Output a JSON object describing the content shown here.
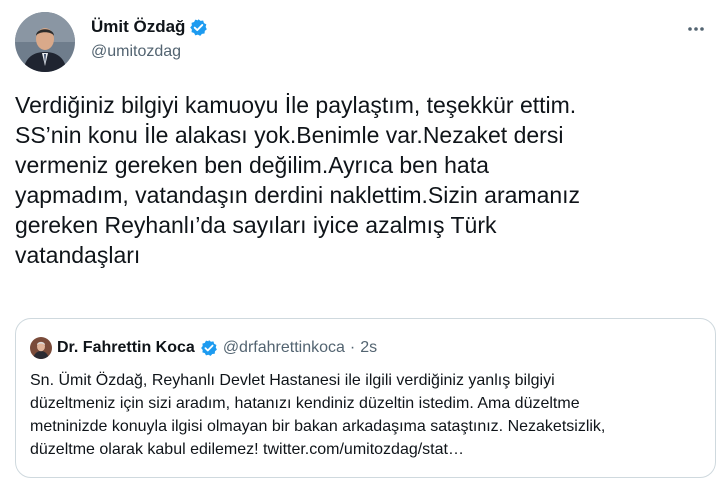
{
  "author": {
    "display_name": "Ümit Özdağ",
    "handle": "@umitozdag"
  },
  "tweet": {
    "lines": [
      "Verdiğiniz bilgiyi kamuoyu İle paylaştım, teşekkür ettim.",
      "SS’nin konu İle alakası yok.Benimle var.Nezaket dersi",
      "vermeniz gereken ben değilim.Ayrıca ben hata",
      "yapmadım, vatandaşın derdini naklettim.Sizin aramanız",
      "gereken Reyhanlı’da sayıları iyice azalmış Türk",
      "vatandaşları"
    ]
  },
  "quoted": {
    "display_name": "Dr. Fahrettin Koca",
    "handle": "@drfahrettinkoca",
    "separator": "·",
    "time": "2s",
    "lines": [
      "Sn. Ümit Özdağ, Reyhanlı Devlet Hastanesi ile ilgili verdiğiniz yanlış bilgiyi",
      "düzeltmeniz için sizi aradım, hatanızı kendiniz düzeltin istedim. Ama düzeltme",
      "metninizde konuyla ilgisi olmayan bir bakan arkadaşıma sataştınız. Nezaketsizlik,",
      "düzeltme olarak kabul edilemez! twitter.com/umitozdag/stat…"
    ]
  },
  "icons": {
    "verified": "verified-badge-icon",
    "more": "more-horizontal-icon"
  },
  "colors": {
    "text_primary": "#0f1419",
    "text_secondary": "#536471",
    "verified_blue": "#1d9bf0",
    "border": "#cfd9de"
  }
}
